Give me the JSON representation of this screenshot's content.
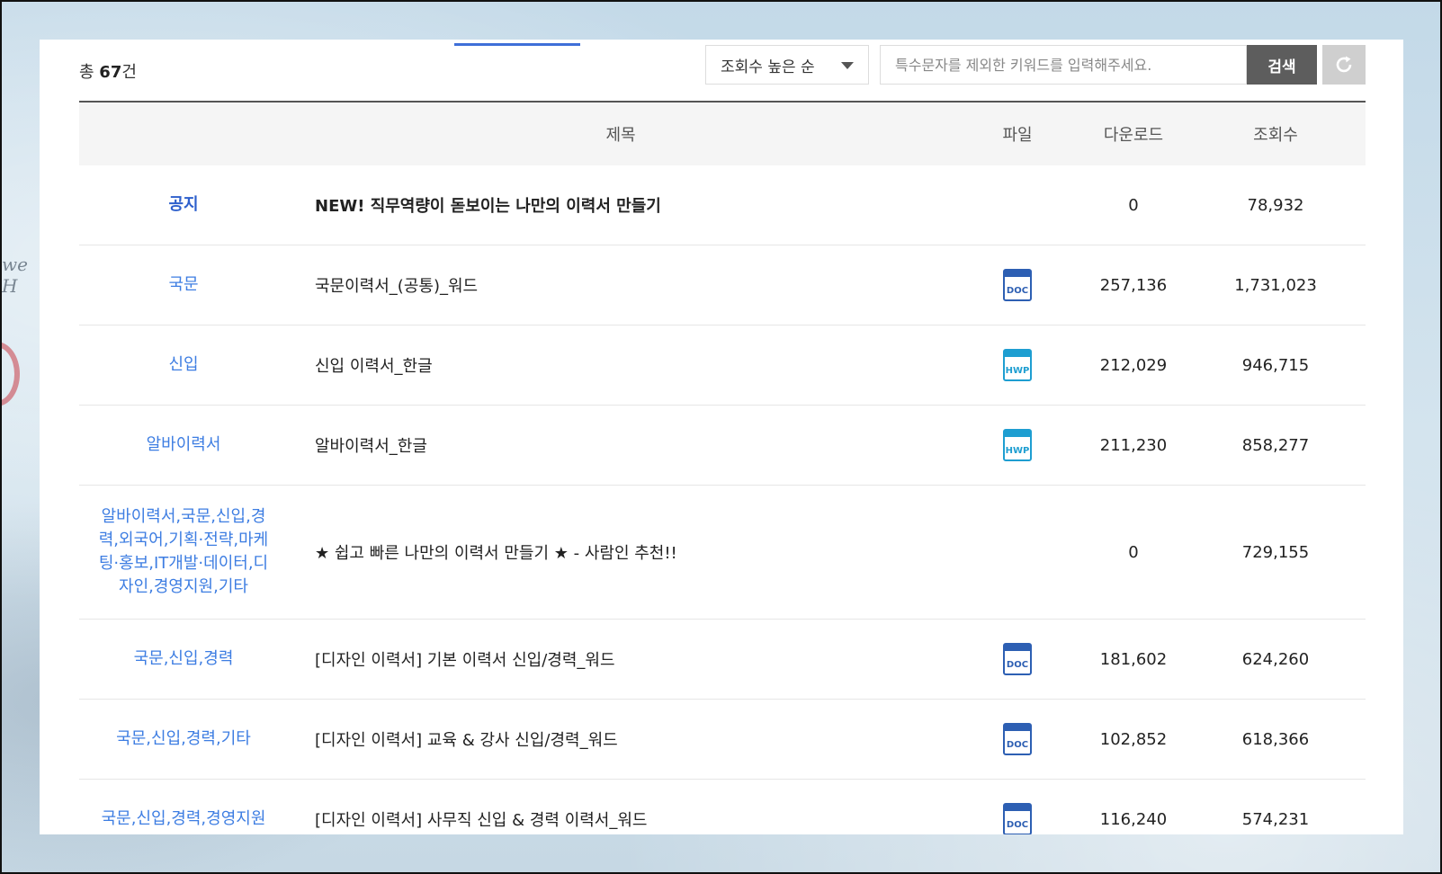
{
  "summary": {
    "prefix": "총 ",
    "count": "67",
    "suffix": "건"
  },
  "sort": {
    "selected": "조회수 높은 순"
  },
  "search": {
    "placeholder": "특수문자를 제외한 키워드를 입력해주세요.",
    "button_label": "검색"
  },
  "table": {
    "headers": {
      "category": "",
      "title": "제목",
      "file": "파일",
      "downloads": "다운로드",
      "views": "조회수"
    },
    "rows": [
      {
        "category": "공지",
        "title": "NEW! 직무역량이 돋보이는 나만의 이력서 만들기",
        "file": "",
        "downloads": "0",
        "views": "78,932"
      },
      {
        "category": "국문",
        "title": "국문이력서_(공통)_워드",
        "file": "DOC",
        "downloads": "257,136",
        "views": "1,731,023"
      },
      {
        "category": "신입",
        "title": "신입 이력서_한글",
        "file": "HWP",
        "downloads": "212,029",
        "views": "946,715"
      },
      {
        "category": "알바이력서",
        "title": "알바이력서_한글",
        "file": "HWP",
        "downloads": "211,230",
        "views": "858,277"
      },
      {
        "category": "알바이력서,국문,신입,경력,외국어,기획·전략,마케팅·홍보,IT개발·데이터,디자인,경영지원,기타",
        "title": "★ 쉽고 빠른 나만의 이력서 만들기 ★ - 사람인 추천!!",
        "file": "",
        "downloads": "0",
        "views": "729,155"
      },
      {
        "category": "국문,신입,경력",
        "title": "[디자인 이력서] 기본 이력서 신입/경력_워드",
        "file": "DOC",
        "downloads": "181,602",
        "views": "624,260"
      },
      {
        "category": "국문,신입,경력,기타",
        "title": "[디자인 이력서] 교육 & 강사 신입/경력_워드",
        "file": "DOC",
        "downloads": "102,852",
        "views": "618,366"
      },
      {
        "category": "국문,신입,경력,경영지원",
        "title": "[디자인 이력서] 사무직 신입 & 경력 이력서_워드",
        "file": "DOC",
        "downloads": "116,240",
        "views": "574,231"
      }
    ]
  },
  "colors": {
    "accent_blue": "#3d7de2",
    "search_button": "#5d5d5d",
    "doc_icon": "#2d5fb3",
    "hwp_icon": "#1e9ed1"
  },
  "icons": {
    "sort_chevron": "chevron-down-icon",
    "reset": "refresh-icon",
    "doc_file": "doc-file-icon",
    "hwp_file": "hwp-file-icon"
  }
}
